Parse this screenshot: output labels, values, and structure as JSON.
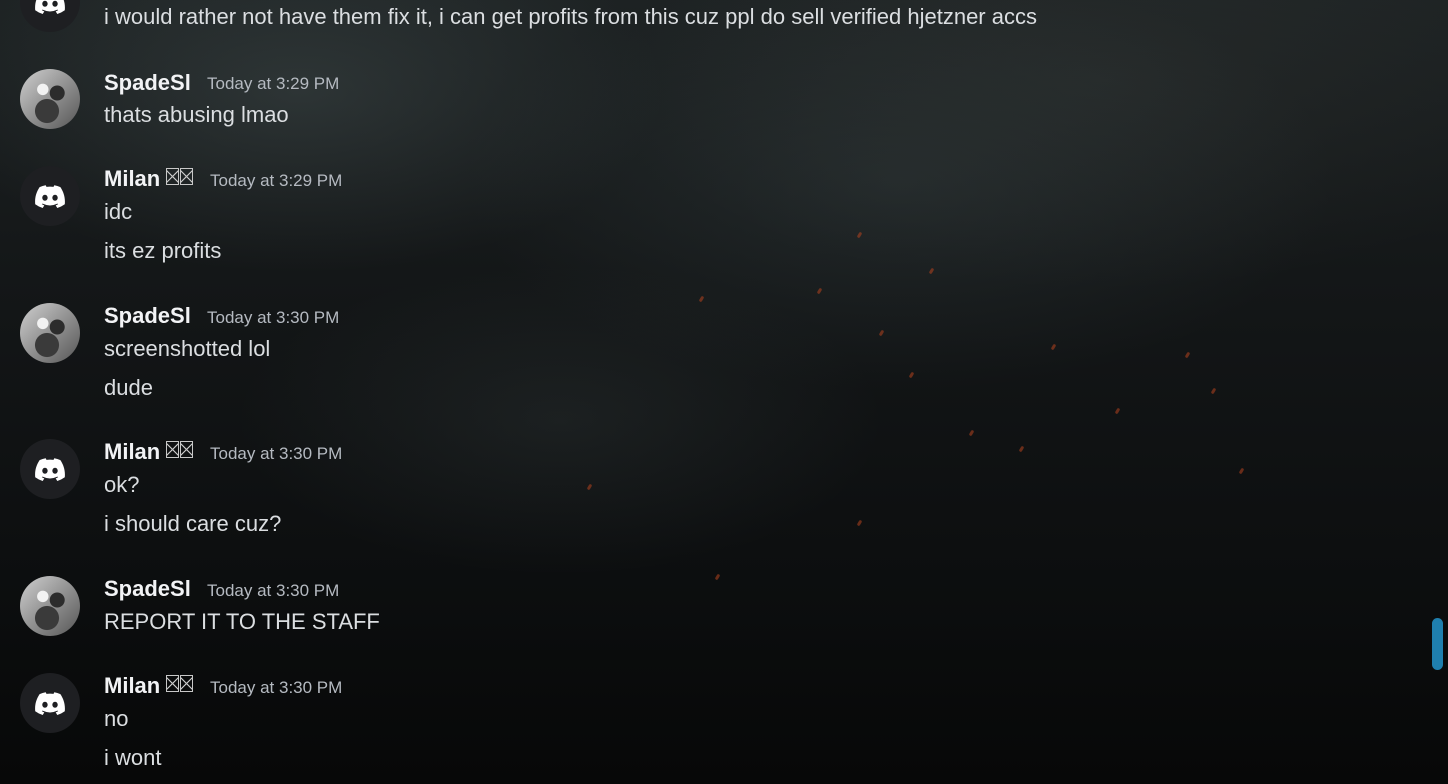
{
  "messages": [
    {
      "text": "i would rather not have them fix it, i can get profits from this cuz ppl do sell verified hjetzner accs"
    },
    {
      "user": "SpadeSl",
      "timestamp": "Today at 3:29 PM",
      "lines": [
        "thats abusing lmao"
      ]
    },
    {
      "user": "Milan",
      "timestamp": "Today at 3:29 PM",
      "lines": [
        "idc",
        "its ez profits"
      ]
    },
    {
      "user": "SpadeSl",
      "timestamp": "Today at 3:30 PM",
      "lines": [
        "screenshotted lol",
        "dude"
      ]
    },
    {
      "user": "Milan",
      "timestamp": "Today at 3:30 PM",
      "lines": [
        "ok?",
        "i should care cuz?"
      ]
    },
    {
      "user": "SpadeSl",
      "timestamp": "Today at 3:30 PM",
      "lines": [
        "REPORT IT TO THE STAFF"
      ]
    },
    {
      "user": "Milan",
      "timestamp": "Today at 3:30 PM",
      "lines": [
        "no",
        "i wont"
      ]
    }
  ],
  "icons": {
    "discord_avatar": "discord-logo-icon",
    "username_tag": "unknown-glyph-icon"
  },
  "colors": {
    "username": "#f2f3f5",
    "message": "#dbdee1",
    "timestamp": "#b5bac1",
    "scrollbar": "#1f7fae",
    "discord_avatar_bg": "#1e1f22"
  }
}
